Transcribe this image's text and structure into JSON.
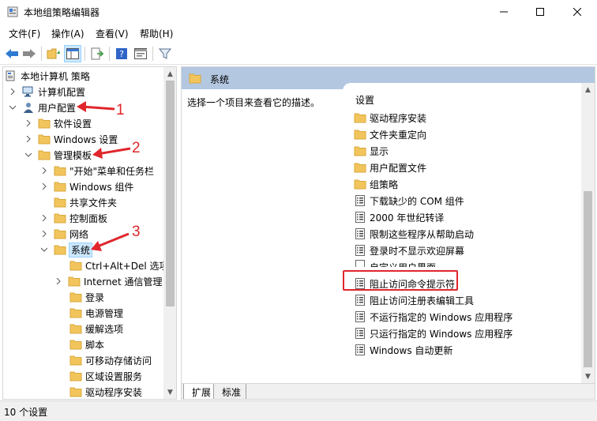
{
  "window": {
    "title": "本地组策略编辑器"
  },
  "menu": [
    {
      "label": "文件(F)"
    },
    {
      "label": "操作(A)"
    },
    {
      "label": "查看(V)"
    },
    {
      "label": "帮助(H)"
    }
  ],
  "tree": {
    "root": "本地计算机 策略",
    "computer_config": "计算机配置",
    "user_config": "用户配置",
    "software_settings": "软件设置",
    "windows_settings": "Windows 设置",
    "admin_templates": "管理模板",
    "start_menu": "\"开始\"菜单和任务栏",
    "windows_components": "Windows 组件",
    "shared_folders": "共享文件夹",
    "control_panel": "控制面板",
    "network": "网络",
    "system": "系统",
    "system_children": [
      {
        "label": "Ctrl+Alt+Del 选项"
      },
      {
        "label": "Internet 通信管理"
      },
      {
        "label": "登录"
      },
      {
        "label": "电源管理"
      },
      {
        "label": "缓解选项"
      },
      {
        "label": "脚本"
      },
      {
        "label": "可移动存储访问"
      },
      {
        "label": "区域设置服务"
      },
      {
        "label": "驱动程序安装"
      }
    ]
  },
  "right": {
    "header_title": "系统",
    "description": "选择一个项目来查看它的描述。",
    "column_header": "设置",
    "items": [
      {
        "label": "驱动程序安装",
        "kind": "folder"
      },
      {
        "label": "文件夹重定向",
        "kind": "folder"
      },
      {
        "label": "显示",
        "kind": "folder"
      },
      {
        "label": "用户配置文件",
        "kind": "folder"
      },
      {
        "label": "组策略",
        "kind": "folder"
      },
      {
        "label": "下载缺少的 COM 组件",
        "kind": "setting"
      },
      {
        "label": "2000 年世纪转译",
        "kind": "setting"
      },
      {
        "label": "限制这些程序从帮助启动",
        "kind": "setting"
      },
      {
        "label": "登录时不显示欢迎屏幕",
        "kind": "setting"
      },
      {
        "label": "自定义用户界面",
        "kind": "setting"
      },
      {
        "label": "阻止访问命令提示符",
        "kind": "setting"
      },
      {
        "label": "阻止访问注册表编辑工具",
        "kind": "setting"
      },
      {
        "label": "不运行指定的 Windows 应用程序",
        "kind": "setting"
      },
      {
        "label": "只运行指定的 Windows 应用程序",
        "kind": "setting"
      },
      {
        "label": "Windows 自动更新",
        "kind": "setting"
      }
    ],
    "tabs": [
      {
        "label": "扩展"
      },
      {
        "label": "标准"
      }
    ]
  },
  "status": {
    "text": "10 个设置"
  },
  "annotations": [
    "1",
    "2",
    "3"
  ],
  "colors": {
    "accent_header": "#b3c7e0",
    "annotation_red": "#e0262c",
    "folder": "#f2c55c"
  }
}
